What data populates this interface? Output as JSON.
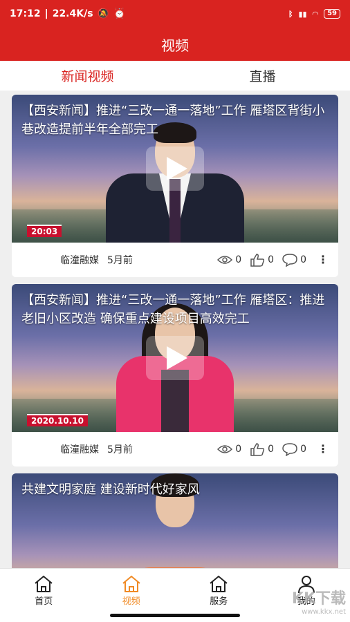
{
  "status_bar": {
    "time": "17:12",
    "speed": "22.4K/s",
    "battery": "59"
  },
  "app_bar": {
    "title": "视频"
  },
  "tabs": [
    {
      "label": "新闻视频",
      "active": true
    },
    {
      "label": "直播",
      "active": false
    }
  ],
  "cards": [
    {
      "title": "【西安新闻】推进“三改一通一落地”工作 雁塔区背街小巷改造提前半年全部完工",
      "timestamp": "20:03",
      "source": "临潼融媒",
      "time_ago": "5月前",
      "views": "0",
      "likes": "0",
      "comments": "0"
    },
    {
      "title": "【西安新闻】推进“三改一通一落地”工作 雁塔区：推进老旧小区改造 确保重点建设项目高效完工",
      "timestamp": "2020.10.10",
      "source": "临潼融媒",
      "time_ago": "5月前",
      "views": "0",
      "likes": "0",
      "comments": "0"
    },
    {
      "title": "共建文明家庭 建设新时代好家风"
    }
  ],
  "bottom_nav": [
    {
      "label": "首页",
      "icon": "home-icon"
    },
    {
      "label": "视频",
      "icon": "video-home-icon",
      "active": true
    },
    {
      "label": "服务",
      "icon": "service-icon"
    },
    {
      "label": "我的",
      "icon": "profile-icon"
    }
  ],
  "watermark": {
    "text": "KK下载",
    "url": "www.kkx.net"
  },
  "colors": {
    "brand_red": "#d92320",
    "active_orange": "#f08a24"
  }
}
